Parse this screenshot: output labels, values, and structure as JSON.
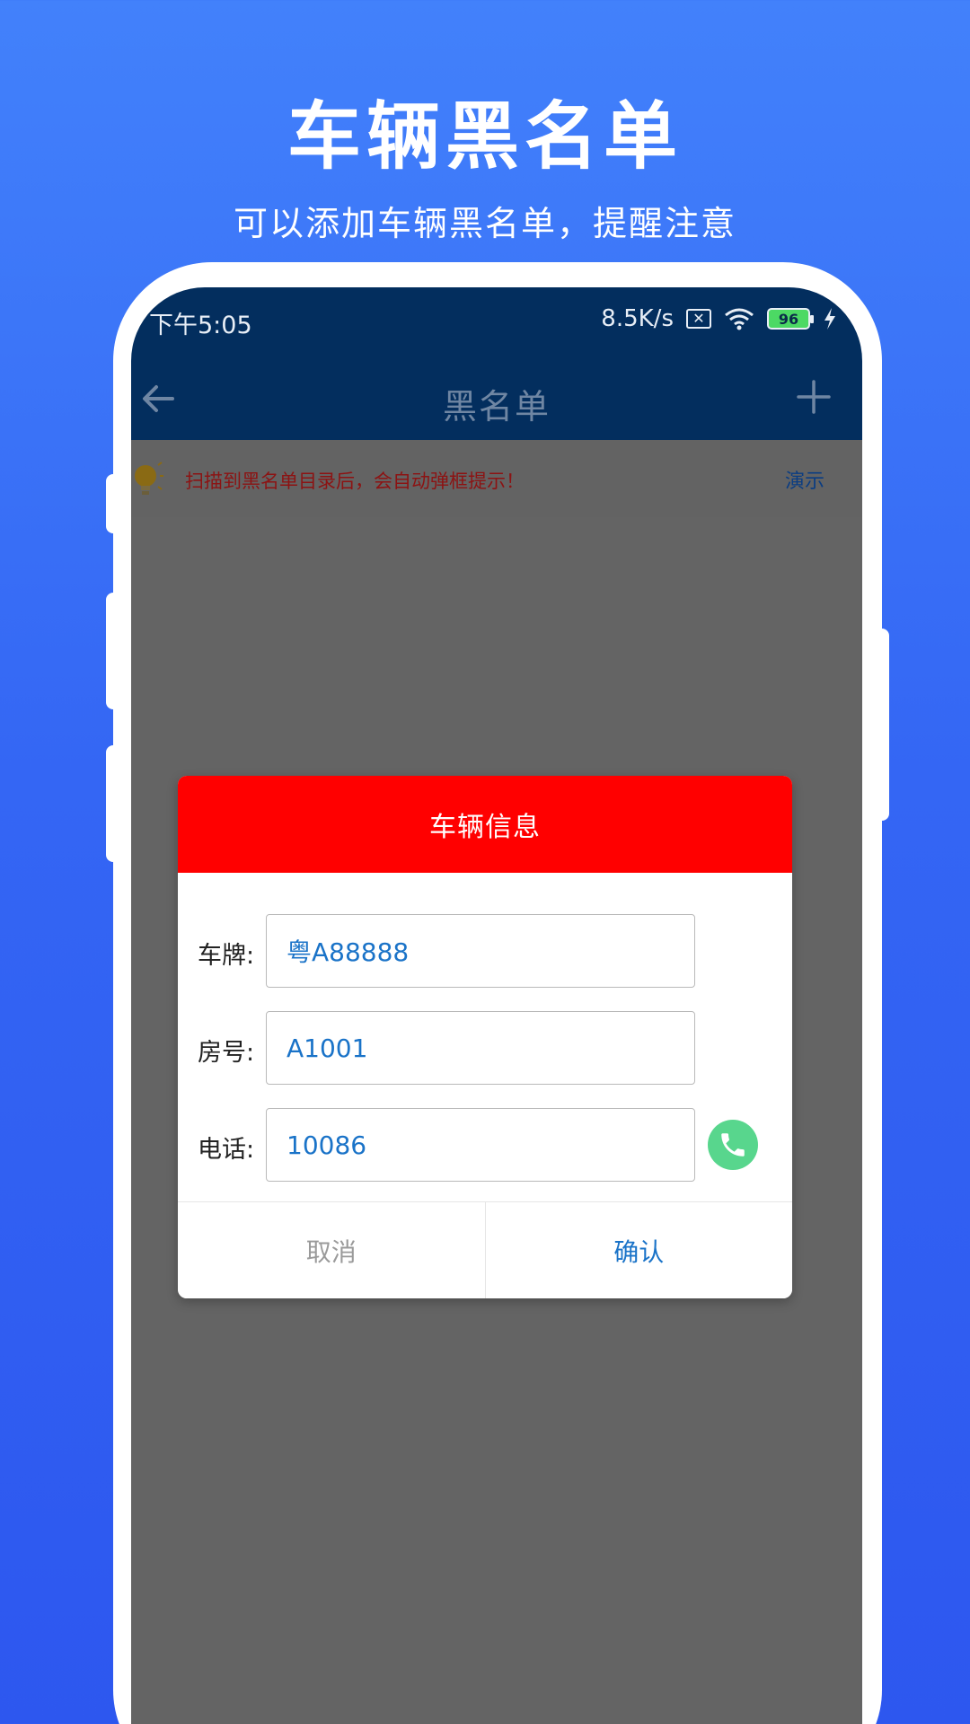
{
  "promo": {
    "title": "车辆黑名单",
    "subtitle": "可以添加车辆黑名单，提醒注意"
  },
  "status_bar": {
    "time": "下午5:05",
    "network_speed": "8.5K/s",
    "battery_level": "96",
    "icons": [
      "sim-x-icon",
      "wifi-icon",
      "battery-icon",
      "charging-icon"
    ]
  },
  "app_bar": {
    "title": "黑名单",
    "back_icon": "arrow-left-icon",
    "add_icon": "plus-icon"
  },
  "notice": {
    "icon": "lightbulb-icon",
    "text": "扫描到黑名单目录后，会自动弹框提示！",
    "link": "演示"
  },
  "dialog": {
    "title": "车辆信息",
    "fields": [
      {
        "label": "车牌:",
        "value": "粤A88888"
      },
      {
        "label": "房号:",
        "value": "A1001"
      },
      {
        "label": "电话:",
        "value": "10086"
      }
    ],
    "call_icon": "phone-call-icon",
    "cancel_label": "取消",
    "confirm_label": "确认"
  },
  "colors": {
    "header_navy": "#032e5e",
    "dialog_header": "#ff0000",
    "accent_blue": "#1a73c8",
    "call_green": "#58d68d",
    "background_blue": "#3466f4"
  }
}
